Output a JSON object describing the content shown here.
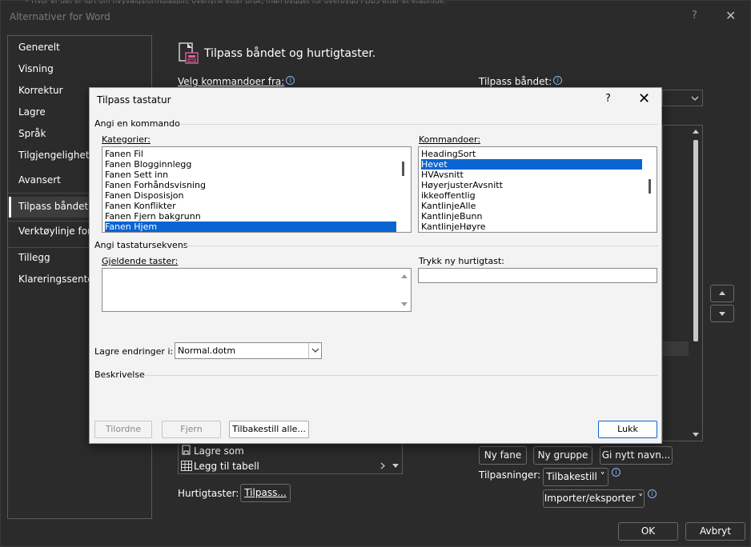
{
  "outer": {
    "title": "Alternativer for Word",
    "help": "?",
    "close": "✕",
    "strip_text": "• Hvor er det er lurt om hvyvalgsformulasjon, overlyrik etter bruk, man bygget for overbygd PDBS etter et etabrilde."
  },
  "nav": {
    "items": [
      "Generelt",
      "Visning",
      "Korrektur",
      "Lagre",
      "Språk",
      "Tilgjengelighet",
      "Avansert",
      "Tilpass båndet",
      "Verktøylinje for h",
      "Tillegg",
      "Klareringssenter"
    ],
    "selected": "Tilpass båndet"
  },
  "main": {
    "header": "Tilpass båndet og hurtigtaster.",
    "velg_label": "Velg kommandoer fra:",
    "tilpass_label": "Tilpass båndet:",
    "list_items": [
      "Lagre som",
      "Legg til tabell"
    ],
    "hurtig_label": "Hurtigtaster:",
    "tilpass_btn": "Tilpass...",
    "ny_fane": "Ny fane",
    "ny_gruppe": "Ny gruppe",
    "gi_nytt": "Gi nytt navn...",
    "tilpasninger_label": "Tilpasninger:",
    "tilbakestill": "Tilbakestill ˅",
    "importer": "Importer/eksporter ˅",
    "ok": "OK",
    "avbryt": "Avbryt"
  },
  "dialog": {
    "title": "Tilpass tastatur",
    "help": "?",
    "close": "✕",
    "group_command": "Angi en kommando",
    "categories_label": "Kategorier:",
    "categories": [
      "Fanen Fil",
      "Fanen Blogginnlegg",
      "Fanen Sett inn",
      "Fanen Forhåndsvisning",
      "Fanen Disposisjon",
      "Fanen Konflikter",
      "Fanen Fjern bakgrunn",
      "Fanen Hjem"
    ],
    "selected_category": "Fanen Hjem",
    "commands_label": "Kommandoer:",
    "commands": [
      "HeadingSort",
      "Hevet",
      "HVAvsnitt",
      "HøyerjusterAvsnitt",
      "ikkeoffentlig",
      "KantlinjeAlle",
      "KantlinjeBunn",
      "KantlinjeHøyre"
    ],
    "selected_command": "Hevet",
    "group_keys": "Angi tastatursekvens",
    "current_keys_label": "Gjeldende taster:",
    "new_key_label": "Trykk ny hurtigtast:",
    "new_key_value": "",
    "save_label": "Lagre endringer i:",
    "save_value": "Normal.dotm",
    "description_label": "Beskrivelse",
    "btn_assign": "Tilordne",
    "btn_remove": "Fjern",
    "btn_reset": "Tilbakestill alle...",
    "btn_close": "Lukk"
  },
  "colors": {
    "accent": "#0a64d2",
    "dark_bg": "#2b2b2b",
    "dialog_bg": "#f3f3f3"
  }
}
